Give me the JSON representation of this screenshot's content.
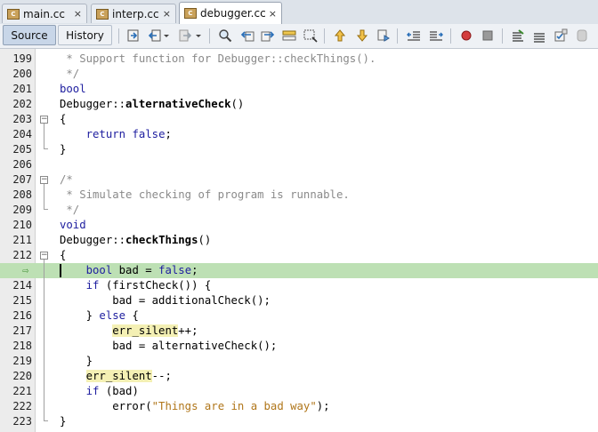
{
  "tabs": [
    {
      "label": "main.cc",
      "close": "×",
      "active": false
    },
    {
      "label": "interp.cc",
      "close": "×",
      "active": false
    },
    {
      "label": "debugger.cc",
      "close": "×",
      "active": true
    }
  ],
  "toolbar": {
    "source_label": "Source",
    "history_label": "History",
    "icons": [
      "last-edit-icon",
      "back-icon",
      "forward-icon",
      "find-icon",
      "find-previous-icon",
      "find-next-icon",
      "toggle-highlight-icon",
      "toggle-rect-selection-icon",
      "previous-bookmark-icon",
      "next-bookmark-icon",
      "toggle-bookmark-icon",
      "shift-left-icon",
      "shift-right-icon",
      "start-macro-icon",
      "stop-macro-icon",
      "comment-icon",
      "uncomment-icon",
      "tasks-icon",
      "diff-icon"
    ],
    "colors": {
      "active_toggle": "#c8d6e8",
      "record": "#d33c3c"
    }
  },
  "editor": {
    "highlight_color": "#bde0b4",
    "lines": [
      {
        "num": "199",
        "text": " * Support function for Debugger::checkThings()."
      },
      {
        "num": "200",
        "text": " */"
      },
      {
        "num": "201",
        "text": "bool"
      },
      {
        "num": "202",
        "text": "Debugger::alternativeCheck()"
      },
      {
        "num": "203",
        "text": "{"
      },
      {
        "num": "204",
        "text": "    return false;"
      },
      {
        "num": "205",
        "text": "}"
      },
      {
        "num": "206",
        "text": ""
      },
      {
        "num": "207",
        "text": "/*"
      },
      {
        "num": "208",
        "text": " * Simulate checking of program is runnable."
      },
      {
        "num": "209",
        "text": " */"
      },
      {
        "num": "210",
        "text": "void"
      },
      {
        "num": "211",
        "text": "Debugger::checkThings()"
      },
      {
        "num": "212",
        "text": "{"
      },
      {
        "num": "",
        "text": "    bool bad = false;"
      },
      {
        "num": "214",
        "text": "    if (firstCheck()) {"
      },
      {
        "num": "215",
        "text": "        bad = additionalCheck();"
      },
      {
        "num": "216",
        "text": "    } else {"
      },
      {
        "num": "217",
        "text": "        err_silent++;"
      },
      {
        "num": "218",
        "text": "        bad = alternativeCheck();"
      },
      {
        "num": "219",
        "text": "    }"
      },
      {
        "num": "220",
        "text": "    err_silent--;"
      },
      {
        "num": "221",
        "text": "    if (bad)"
      },
      {
        "num": "222",
        "text": "        error(\"Things are in a bad way\");"
      },
      {
        "num": "223",
        "text": "}"
      }
    ]
  }
}
